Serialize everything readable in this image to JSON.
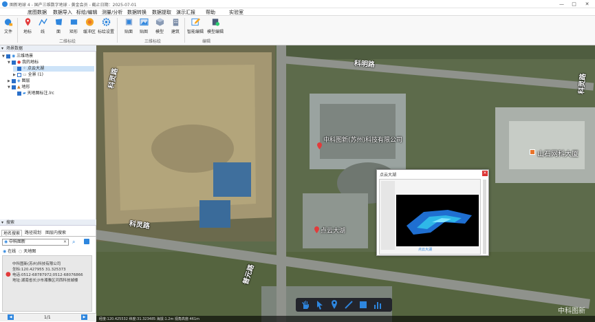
{
  "window": {
    "title": "图新地球 4 - 国产三维数字地球 - 黄金会员 - 截止日期：2025-07-01",
    "controls": [
      "—",
      "□",
      "✕"
    ]
  },
  "menu": [
    "底图数据",
    "数据导入",
    "标绘/编辑",
    "测量/分析",
    "数据转换",
    "数据提取",
    "演示汇报",
    "帮助",
    "实验室"
  ],
  "ribbon": {
    "file_label": "文件",
    "tools_2d": [
      "地标",
      "线",
      "面",
      "矩形",
      "缓冲区",
      "标绘设置"
    ],
    "tools_3d": [
      "贴面",
      "贴图",
      "模型",
      "建筑"
    ],
    "tools_edit": [
      "智能编辑",
      "模型编辑"
    ],
    "groups": [
      "二维标绘",
      "三维标绘",
      "编辑"
    ]
  },
  "scene": {
    "header": "场景数据",
    "tree": [
      {
        "label": "三维场景"
      },
      {
        "label": "我的地标"
      },
      {
        "label": "点云大湖"
      },
      {
        "label": "全景 (1)"
      },
      {
        "label": "图层"
      },
      {
        "label": "地形"
      },
      {
        "label": "天地图标注.lrc"
      }
    ]
  },
  "search": {
    "header": "搜索",
    "tabs": [
      "地名搜索",
      "路径规划",
      "图层内搜索"
    ],
    "query": "中科图新",
    "scopes": [
      "在线",
      "天地图"
    ],
    "result": {
      "name": "中科图新(苏州)科技有限公司",
      "coords": "坐标:120.427955 31.325373",
      "phone": "电话:0512-68787972;0512-68076866",
      "address": "地址:湖南省长沙市湘雅区河西科技城楼"
    },
    "pager": "1/1"
  },
  "map": {
    "roads": [
      "科明路",
      "科灵路",
      "科灵路",
      "科灵路",
      "普元路"
    ],
    "poi_labels": [
      "中科图新(苏州)科技有限公司",
      "山石网科大厦",
      "点云大湖"
    ],
    "watermark": "中科图新",
    "statusbar": "经度:120.425532 纬度:31.323485 海拔:1.2m  视角高度:461m"
  },
  "popup": {
    "title": "点云大湖",
    "chart_caption": "点云大湖",
    "close": "✕"
  }
}
